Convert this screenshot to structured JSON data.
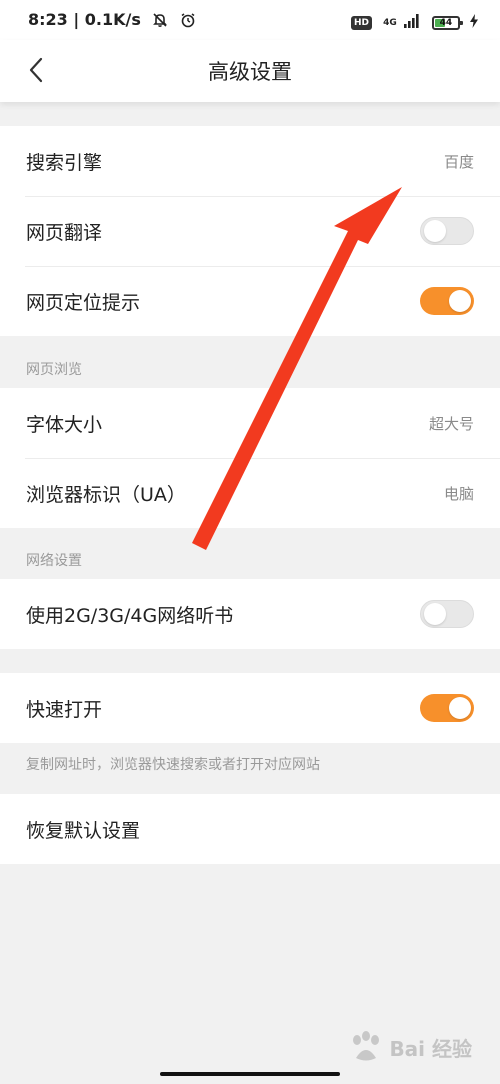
{
  "status_bar": {
    "time_speed": "8:23 | 0.1K/s",
    "hd_label": "HD",
    "network_label": "4G",
    "battery_level": "44",
    "icons": [
      "muted-notification-icon",
      "alarm-icon",
      "signal-icon",
      "battery-icon",
      "charging-icon"
    ]
  },
  "header": {
    "title": "高级设置",
    "back_icon": "chevron-left-icon"
  },
  "settings": {
    "search_engine": {
      "label": "搜索引擎",
      "value": "百度"
    },
    "page_translate": {
      "label": "网页翻译",
      "toggle": "off"
    },
    "location_prompt": {
      "label": "网页定位提示",
      "toggle": "on"
    },
    "section_browse": "网页浏览",
    "font_size": {
      "label": "字体大小",
      "value": "超大号"
    },
    "user_agent": {
      "label": "浏览器标识（UA）",
      "value": "电脑"
    },
    "section_network": "网络设置",
    "mobile_audiobook": {
      "label": "使用2G/3G/4G网络听书",
      "toggle": "off"
    },
    "quick_open": {
      "label": "快速打开",
      "toggle": "on"
    },
    "quick_open_hint": "复制网址时，浏览器快速搜索或者打开对应网站",
    "restore_defaults": {
      "label": "恢复默认设置"
    }
  },
  "watermark": {
    "text": "Bai 经验"
  },
  "colors": {
    "accent": "#f7902b",
    "background": "#f1f1f1",
    "arrow": "#f23a1f"
  }
}
